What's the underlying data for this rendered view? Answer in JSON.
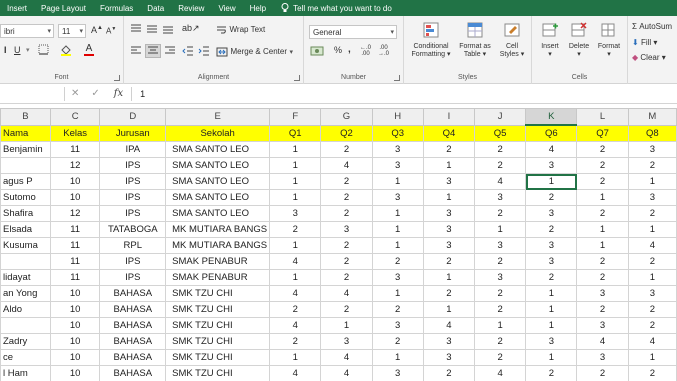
{
  "ribbon_tabs": [
    "Insert",
    "Page Layout",
    "Formulas",
    "Data",
    "Review",
    "View",
    "Help"
  ],
  "tell_me": "Tell me what you want to do",
  "font": {
    "name": "ibri",
    "size": "11",
    "group_label": "Font"
  },
  "alignment": {
    "wrap_text": "Wrap Text",
    "merge_center": "Merge & Center",
    "group_label": "Alignment"
  },
  "number": {
    "format": "General",
    "group_label": "Number"
  },
  "styles": {
    "conditional_formatting": [
      "Conditional",
      "Formatting"
    ],
    "format_as_table": [
      "Format as",
      "Table"
    ],
    "cell_styles": [
      "Cell",
      "Styles"
    ],
    "group_label": "Styles"
  },
  "cells": {
    "insert": "Insert",
    "delete": "Delete",
    "format": "Format",
    "group_label": "Cells"
  },
  "editing": {
    "autosum": "AutoSum",
    "fill": "Fill",
    "clear": "Clear"
  },
  "formula_bar": {
    "value": "1"
  },
  "colors": {
    "ribbon_green": "#217346",
    "header_fill": "#ffff00"
  },
  "grid": {
    "columns": [
      "B",
      "C",
      "D",
      "E",
      "F",
      "G",
      "H",
      "I",
      "J",
      "K",
      "L",
      "M"
    ],
    "selected_column": "K",
    "header_row": [
      "Nama",
      "Kelas",
      "Jurusan",
      "Sekolah",
      "Q1",
      "Q2",
      "Q3",
      "Q4",
      "Q5",
      "Q6",
      "Q7",
      "Q8"
    ],
    "rows": [
      [
        "Benjamin",
        "11",
        "IPA",
        "SMA SANTO LEO",
        "1",
        "2",
        "3",
        "2",
        "2",
        "4",
        "2",
        "3"
      ],
      [
        "",
        "12",
        "IPS",
        "SMA SANTO LEO",
        "1",
        "4",
        "3",
        "1",
        "2",
        "3",
        "2",
        "2"
      ],
      [
        "agus P",
        "10",
        "IPS",
        "SMA SANTO LEO",
        "1",
        "2",
        "1",
        "3",
        "4",
        "1",
        "2",
        "1"
      ],
      [
        "Sutomo",
        "10",
        "IPS",
        "SMA SANTO LEO",
        "1",
        "2",
        "3",
        "1",
        "3",
        "2",
        "1",
        "3"
      ],
      [
        "Shafira",
        "12",
        "IPS",
        "SMA SANTO LEO",
        "3",
        "2",
        "1",
        "3",
        "2",
        "3",
        "2",
        "2"
      ],
      [
        "Elsada",
        "11",
        "TATABOGA",
        "MK MUTIARA BANGS",
        "2",
        "3",
        "1",
        "3",
        "1",
        "2",
        "1",
        "1"
      ],
      [
        "Kusuma",
        "11",
        "RPL",
        "MK MUTIARA BANGS",
        "1",
        "2",
        "1",
        "3",
        "3",
        "3",
        "1",
        "4"
      ],
      [
        "",
        "11",
        "IPS",
        "SMAK PENABUR",
        "4",
        "2",
        "2",
        "2",
        "2",
        "3",
        "2",
        "2"
      ],
      [
        "lidayat",
        "11",
        "IPS",
        "SMAK PENABUR",
        "1",
        "2",
        "3",
        "1",
        "3",
        "2",
        "2",
        "1"
      ],
      [
        "an Yong",
        "10",
        "BAHASA",
        "SMK TZU CHI",
        "4",
        "4",
        "1",
        "2",
        "2",
        "1",
        "3",
        "3"
      ],
      [
        "Aldo",
        "10",
        "BAHASA",
        "SMK TZU CHI",
        "2",
        "2",
        "2",
        "1",
        "2",
        "1",
        "2",
        "2"
      ],
      [
        "",
        "10",
        "BAHASA",
        "SMK TZU CHI",
        "4",
        "1",
        "3",
        "4",
        "1",
        "1",
        "3",
        "2"
      ],
      [
        "Zadry",
        "10",
        "BAHASA",
        "SMK TZU CHI",
        "2",
        "3",
        "2",
        "3",
        "2",
        "3",
        "4",
        "4"
      ],
      [
        "ce",
        "10",
        "BAHASA",
        "SMK TZU CHI",
        "1",
        "4",
        "1",
        "3",
        "2",
        "1",
        "3",
        "1"
      ],
      [
        "l Ham",
        "10",
        "BAHASA",
        "SMK TZU CHI",
        "4",
        "4",
        "3",
        "2",
        "4",
        "2",
        "2",
        "2"
      ]
    ]
  }
}
